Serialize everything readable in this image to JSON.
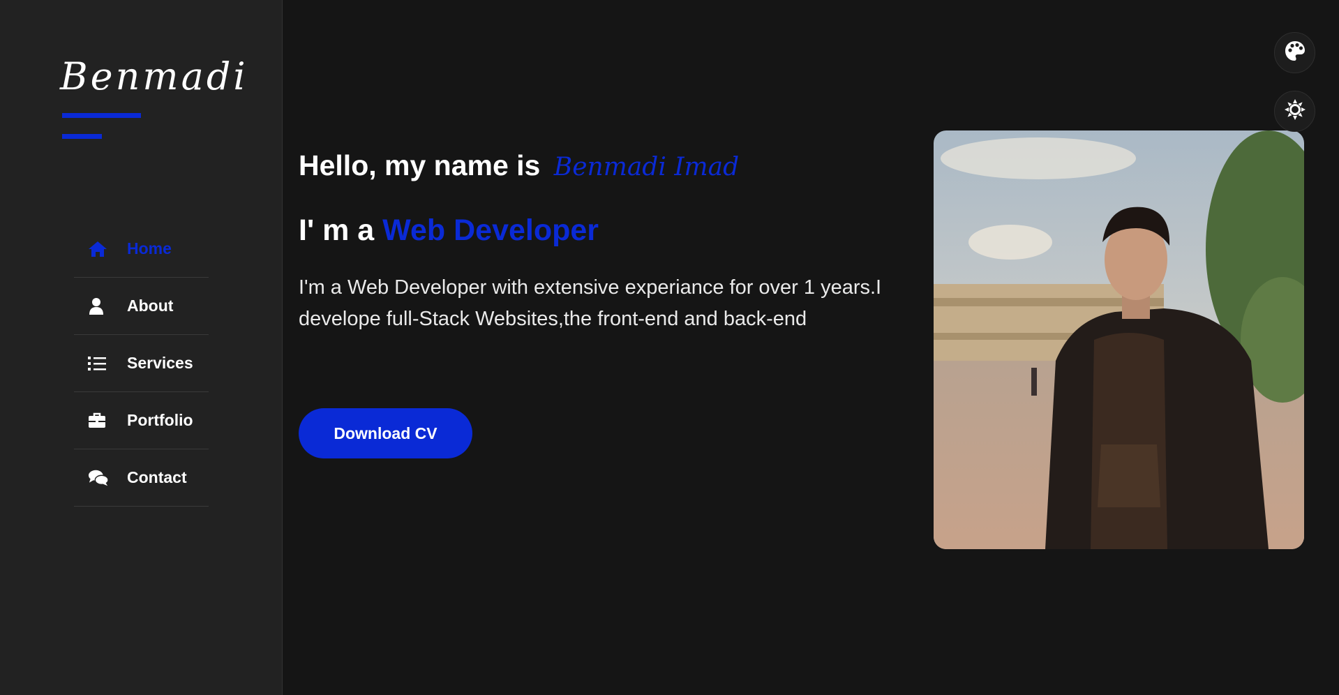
{
  "sidebar": {
    "logo": "Benmadi",
    "items": [
      {
        "label": "Home",
        "icon": "home-icon",
        "active": true
      },
      {
        "label": "About",
        "icon": "user-icon",
        "active": false
      },
      {
        "label": "Services",
        "icon": "list-icon",
        "active": false
      },
      {
        "label": "Portfolio",
        "icon": "briefcase-icon",
        "active": false
      },
      {
        "label": "Contact",
        "icon": "comments-icon",
        "active": false
      }
    ]
  },
  "hero": {
    "greeting_prefix": "Hello, my name is",
    "name": "Benmadi Imad",
    "role_prefix": "I' m a",
    "role": "Web Developer",
    "description": "I'm a Web Developer with extensive experiance for over 1 years.I develope full-Stack Websites,the front-end and back-end",
    "cv_button": "Download CV"
  },
  "controls": {
    "palette": "palette-icon",
    "theme": "sun-icon"
  },
  "colors": {
    "accent": "#0a2ad6",
    "background": "#151515",
    "sidebar": "#222222",
    "text": "#ffffff"
  }
}
